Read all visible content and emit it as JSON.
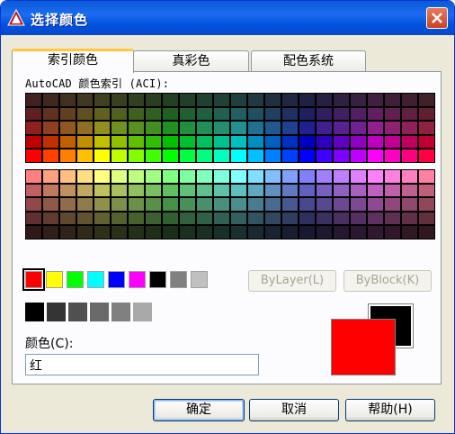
{
  "window": {
    "title": "选择颜色",
    "icon": "autocad-app-icon",
    "close_icon": "close-icon"
  },
  "tabs": [
    {
      "label": "索引颜色",
      "active": true
    },
    {
      "label": "真彩色",
      "active": false
    },
    {
      "label": "配色系统",
      "active": false
    }
  ],
  "aci": {
    "label": "AutoCAD 颜色索引 (ACI):",
    "columns": 24,
    "rows_per_block": 5,
    "colors_top": [
      [
        "#402020",
        "#402820",
        "#403020",
        "#403820",
        "#404020",
        "#384020",
        "#304020",
        "#284020",
        "#204020",
        "#204028",
        "#204030",
        "#204038",
        "#204040",
        "#203840",
        "#203040",
        "#202840",
        "#202040",
        "#282040",
        "#302040",
        "#382040",
        "#402040",
        "#402038",
        "#402030",
        "#402028"
      ],
      [
        "#602020",
        "#603020",
        "#604020",
        "#605020",
        "#606020",
        "#506020",
        "#406020",
        "#306020",
        "#206020",
        "#206030",
        "#206040",
        "#206050",
        "#206060",
        "#205060",
        "#204060",
        "#203060",
        "#202060",
        "#302060",
        "#402060",
        "#502060",
        "#602060",
        "#602050",
        "#602040",
        "#602030"
      ],
      [
        "#902020",
        "#904020",
        "#905820",
        "#907020",
        "#909020",
        "#709020",
        "#589020",
        "#409020",
        "#209020",
        "#209040",
        "#209058",
        "#209070",
        "#209090",
        "#207090",
        "#205890",
        "#204090",
        "#202090",
        "#402090",
        "#582090",
        "#702090",
        "#902090",
        "#902070",
        "#902058",
        "#902040"
      ],
      [
        "#c00000",
        "#c03000",
        "#c06000",
        "#c09000",
        "#c0c000",
        "#90c000",
        "#60c000",
        "#30c000",
        "#00c000",
        "#00c030",
        "#00c060",
        "#00c090",
        "#00c0c0",
        "#0090c0",
        "#0060c0",
        "#0030c0",
        "#0000c0",
        "#3000c0",
        "#6000c0",
        "#9000c0",
        "#c000c0",
        "#c00090",
        "#c00060",
        "#c00030"
      ],
      [
        "#ff0000",
        "#ff4000",
        "#ff8000",
        "#ffc000",
        "#ffff00",
        "#c0ff00",
        "#80ff00",
        "#40ff00",
        "#00ff00",
        "#00ff40",
        "#00ff80",
        "#00ffc0",
        "#00ffff",
        "#00c0ff",
        "#0080ff",
        "#0040ff",
        "#0000ff",
        "#4000ff",
        "#8000ff",
        "#c000ff",
        "#ff00ff",
        "#ff00c0",
        "#ff0080",
        "#ff0040"
      ]
    ],
    "colors_bottom": [
      [
        "#ff8080",
        "#ffa080",
        "#ffbf80",
        "#ffdf80",
        "#ffff80",
        "#dfff80",
        "#bfff80",
        "#a0ff80",
        "#80ff80",
        "#80ffa0",
        "#80ffbf",
        "#80ffdf",
        "#80ffff",
        "#80dfff",
        "#80bfff",
        "#80a0ff",
        "#8080ff",
        "#a080ff",
        "#bf80ff",
        "#df80ff",
        "#ff80ff",
        "#ff80df",
        "#ff80bf",
        "#ff80a0"
      ],
      [
        "#c06060",
        "#c07860",
        "#c09060",
        "#c0a860",
        "#c0c060",
        "#a8c060",
        "#90c060",
        "#78c060",
        "#60c060",
        "#60c078",
        "#60c090",
        "#60c0a8",
        "#60c0c0",
        "#60a8c0",
        "#6090c0",
        "#6078c0",
        "#6060c0",
        "#7860c0",
        "#9060c0",
        "#a860c0",
        "#c060c0",
        "#c060a8",
        "#c06090",
        "#c06078"
      ],
      [
        "#904848",
        "#905848",
        "#906c48",
        "#907c48",
        "#909048",
        "#7c9048",
        "#6c9048",
        "#589048",
        "#489048",
        "#489058",
        "#48906c",
        "#48907c",
        "#489090",
        "#487c90",
        "#486c90",
        "#485890",
        "#484890",
        "#584890",
        "#6c4890",
        "#7c4890",
        "#904890",
        "#90487c",
        "#90486c",
        "#904858"
      ],
      [
        "#603030",
        "#603c30",
        "#604830",
        "#605430",
        "#606030",
        "#546030",
        "#486030",
        "#3c6030",
        "#306030",
        "#30603c",
        "#306048",
        "#306054",
        "#306060",
        "#305460",
        "#304860",
        "#303c60",
        "#303060",
        "#3c3060",
        "#483060",
        "#543060",
        "#603060",
        "#603054",
        "#603048",
        "#60303c"
      ],
      [
        "#301818",
        "#301e18",
        "#302418",
        "#302a18",
        "#303018",
        "#2a3018",
        "#243018",
        "#1e3018",
        "#183018",
        "#18301e",
        "#183024",
        "#18302a",
        "#183030",
        "#182a30",
        "#182430",
        "#181e30",
        "#181830",
        "#1e1830",
        "#241830",
        "#2a1830",
        "#301830",
        "#30182a",
        "#301824",
        "#30181e"
      ]
    ]
  },
  "standard_colors": [
    "#ff0000",
    "#ffff00",
    "#00ff00",
    "#00ffff",
    "#0000ff",
    "#ff00ff",
    "#000000",
    "#808080",
    "#c0c0c0"
  ],
  "selected_standard_index": 0,
  "gray_colors": [
    "#000000",
    "#333333",
    "#505050",
    "#696969",
    "#808080",
    "#a8a8a8"
  ],
  "bylayer_label": "ByLayer(L)",
  "byblock_label": "ByBlock(K)",
  "color_field": {
    "label": "颜色(C):",
    "value": "红"
  },
  "preview": {
    "old_color": "#000000",
    "new_color": "#ff0000"
  },
  "buttons": {
    "ok": "确定",
    "cancel": "取消",
    "help": "帮助(H)"
  }
}
